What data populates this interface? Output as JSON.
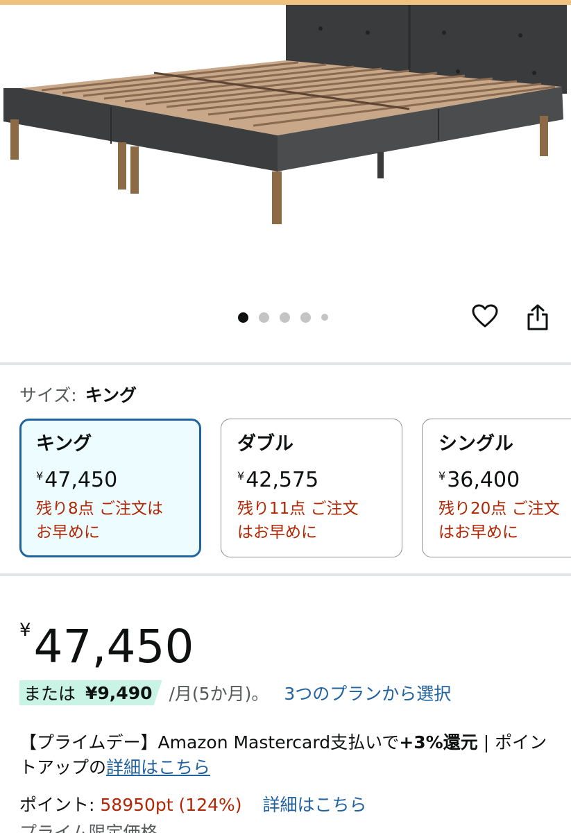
{
  "carousel": {
    "count": 5,
    "active": 0
  },
  "size_selector": {
    "label": "サイズ:",
    "selected": "キング",
    "options": [
      {
        "title": "キング",
        "yen": "¥",
        "price": "47,450",
        "stock": "残り8点 ご注文は\nお早めに"
      },
      {
        "title": "ダブル",
        "yen": "¥",
        "price": "42,575",
        "stock": "残り11点 ご注文\nはお早めに"
      },
      {
        "title": "シングル",
        "yen": "¥",
        "price": "36,400",
        "stock": "残り20点 ご注文\nはお早めに"
      }
    ]
  },
  "price": {
    "yen": "¥",
    "amount": "47,450"
  },
  "installment": {
    "prefix": "または",
    "amount": "¥9,490",
    "period": "/月(5か月)。",
    "link": "3つのプランから選択"
  },
  "promo": {
    "text": "【プライムデー】Amazon Mastercard支払いで",
    "bold": "+3%還元",
    "rest": " | ポイントアップの",
    "link": "詳細はこちら"
  },
  "points": {
    "label": "ポイント:",
    "value": "58950pt",
    "percent": "(124%)",
    "link": "詳細はこちら"
  },
  "prime_note": "プライム限定価格",
  "colors": {
    "accent_blue": "#2162a1",
    "deal_red": "#b12704",
    "selected_bg": "#edfdff",
    "installment_bg": "#c8f3e5",
    "top_strip": "#f0c27f"
  }
}
